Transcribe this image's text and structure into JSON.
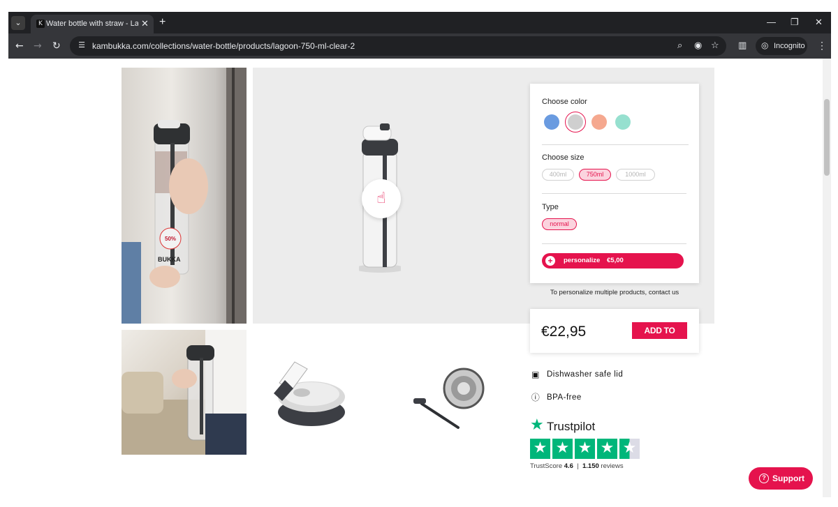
{
  "browser": {
    "tab_title": "Water bottle with straw - Lagoon",
    "tab_favicon": "K",
    "url": "kambukka.com/collections/water-bottle/products/lagoon-750-ml-clear-2",
    "profile_label": "Incognito"
  },
  "options": {
    "color_label": "Choose color",
    "colors": [
      "#6a9be0",
      "#cfcfcf",
      "#f5a88f",
      "#96e0cf"
    ],
    "selected_color_index": 1,
    "size_label": "Choose size",
    "sizes": [
      "400ml",
      "750ml",
      "1000ml"
    ],
    "selected_size": "750ml",
    "type_label": "Type",
    "types": [
      "normal"
    ],
    "personalize_label": "personalize",
    "personalize_price": "€5,00",
    "contact_note": "To personalize multiple products, contact us"
  },
  "cart": {
    "price": "€22,95",
    "add_to_cart_label": "ADD TO CART"
  },
  "features": [
    {
      "icon": "dishwasher-icon",
      "label": "Dishwasher safe lid"
    },
    {
      "icon": "info-icon",
      "label": "BPA-free"
    }
  ],
  "trustpilot": {
    "brand": "Trustpilot",
    "trustscore_label": "TrustScore",
    "score": "4.6",
    "reviews_count": "1.150",
    "reviews_label": "reviews",
    "rating_out_of_5": 4.5
  },
  "support": {
    "label": "Support"
  },
  "colors": {
    "accent": "#e5134d",
    "trustpilot_green": "#00b67a"
  }
}
